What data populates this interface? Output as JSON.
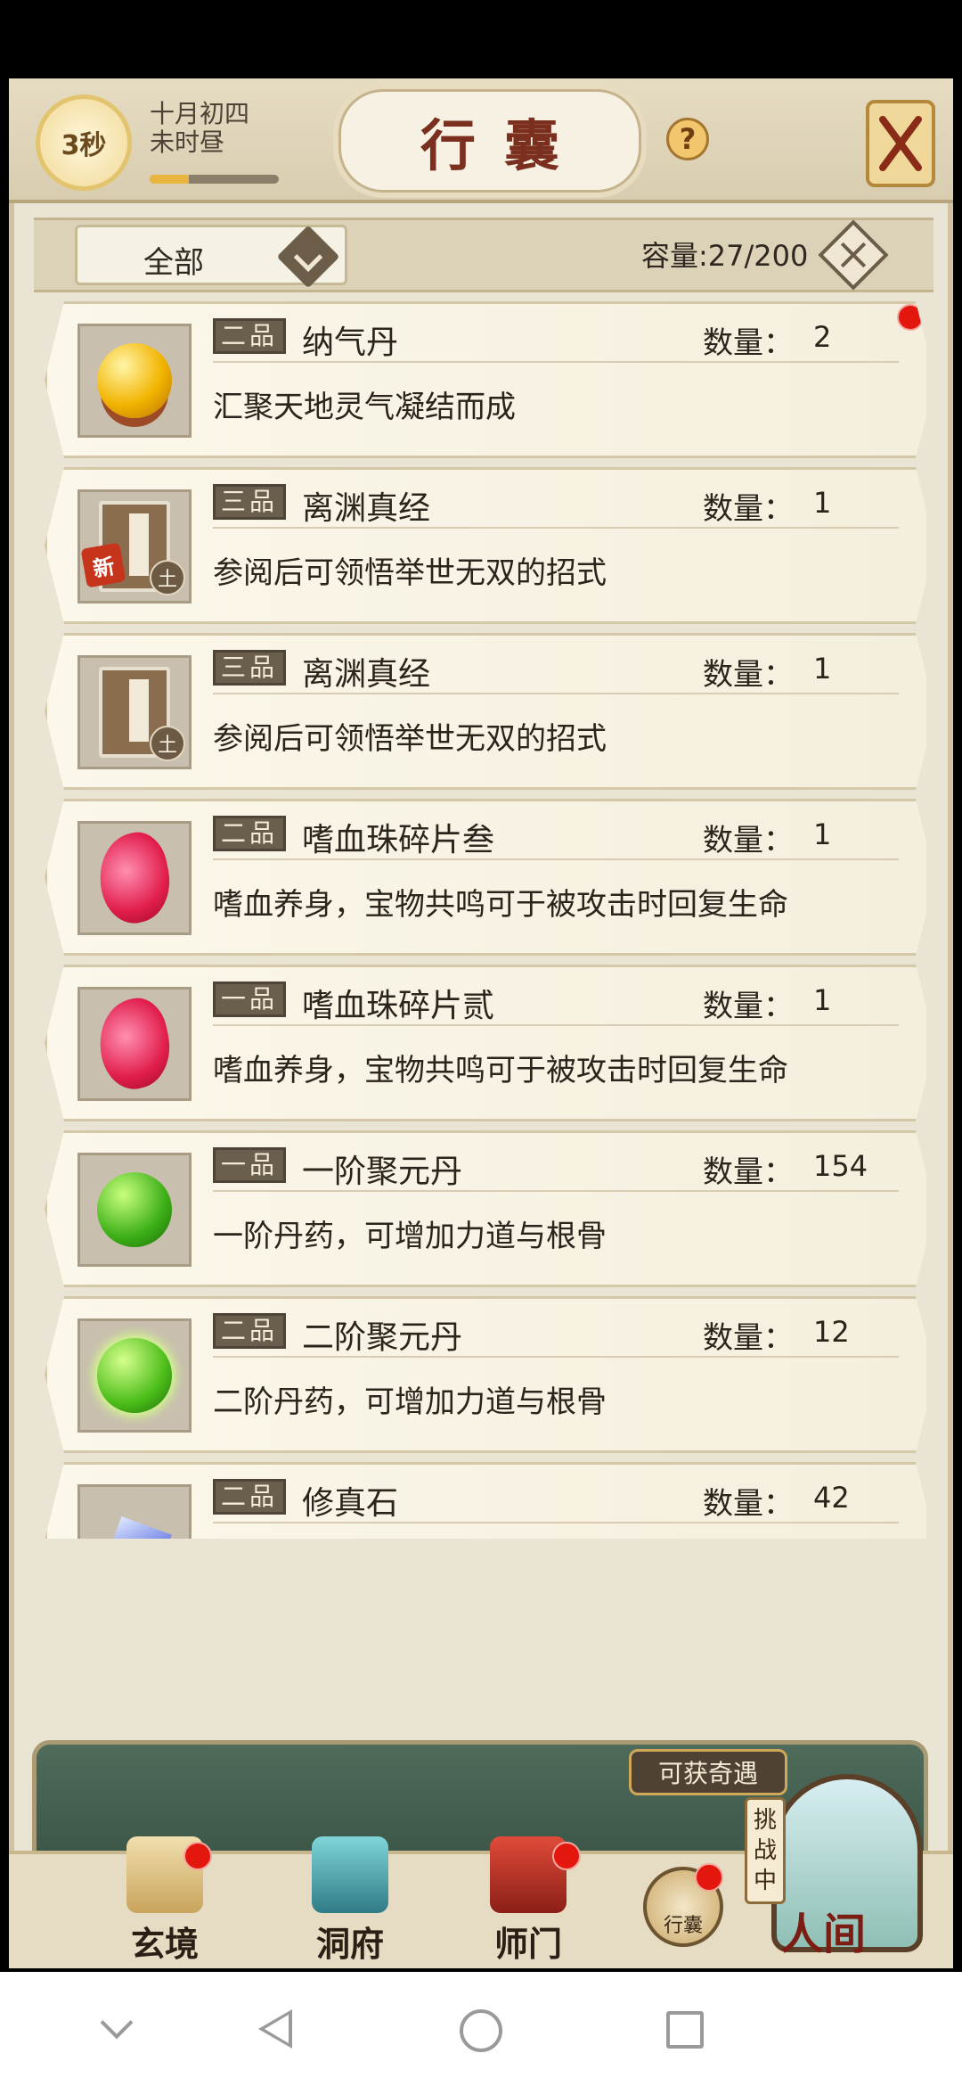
{
  "header": {
    "timer": "3秒",
    "date_line1": "十月初四",
    "date_line2": "未时昼",
    "title": "行囊",
    "help_symbol": "?",
    "time_progress": 0.3
  },
  "filter": {
    "selected": "全部",
    "capacity": "容量:27/200"
  },
  "items": [
    {
      "grade": "二品",
      "name": "纳气丹",
      "qty_label": "数量：",
      "qty": "2",
      "desc": "汇聚天地灵气凝结而成",
      "icon": "golden-pill-icon",
      "is_new": false,
      "has_dot": true
    },
    {
      "grade": "三品",
      "name": "离渊真经",
      "qty_label": "数量：",
      "qty": "1",
      "desc": "参阅后可领悟举世无双的招式",
      "icon": "scripture-book-icon",
      "is_new": true,
      "new_label": "新",
      "element_label": "土",
      "has_dot": false
    },
    {
      "grade": "三品",
      "name": "离渊真经",
      "qty_label": "数量：",
      "qty": "1",
      "desc": "参阅后可领悟举世无双的招式",
      "icon": "scripture-book-icon",
      "is_new": false,
      "element_label": "土",
      "has_dot": false
    },
    {
      "grade": "二品",
      "name": "嗜血珠碎片叁",
      "qty_label": "数量：",
      "qty": "1",
      "desc": "嗜血养身，宝物共鸣可于被攻击时回复生命",
      "icon": "blood-shard-icon",
      "has_dot": false
    },
    {
      "grade": "一品",
      "name": "嗜血珠碎片贰",
      "qty_label": "数量：",
      "qty": "1",
      "desc": "嗜血养身，宝物共鸣可于被攻击时回复生命",
      "icon": "blood-shard-icon",
      "has_dot": false
    },
    {
      "grade": "一品",
      "name": "一阶聚元丹",
      "qty_label": "数量：",
      "qty": "154",
      "desc": "一阶丹药，可增加力道与根骨",
      "icon": "green-pill-icon",
      "has_dot": false
    },
    {
      "grade": "二品",
      "name": "二阶聚元丹",
      "qty_label": "数量：",
      "qty": "12",
      "desc": "二阶丹药，可增加力道与根骨",
      "icon": "glowing-green-pill-icon",
      "has_dot": false
    },
    {
      "grade": "二品",
      "name": "修真石",
      "qty_label": "数量：",
      "qty": "42",
      "desc": "",
      "icon": "crystal-icon",
      "has_dot": false
    }
  ],
  "bottom_nav": {
    "xuanjing": "玄境",
    "dongfu": "洞府",
    "shimen": "师门",
    "bag": "行囊",
    "adventure": "可获奇遇",
    "challenge": "挑战中",
    "world": "人间"
  },
  "colors": {
    "accent_red": "#e3170d",
    "title_red": "#7a2f1f",
    "panel_green": "#3f5c4c"
  }
}
